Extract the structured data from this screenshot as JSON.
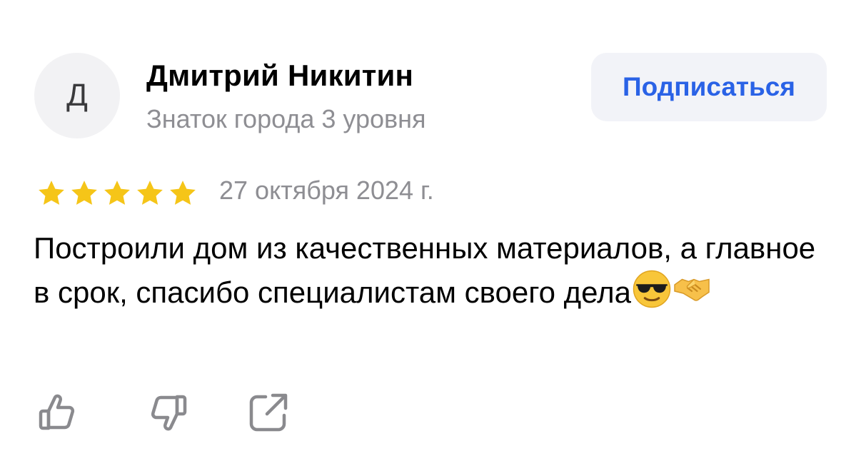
{
  "author": {
    "avatar_letter": "Д",
    "name": "Дмитрий Никитин",
    "level": "Знаток города 3 уровня"
  },
  "subscribe_label": "Подписаться",
  "review": {
    "rating": 5,
    "rating_max": 5,
    "date": "27 октября 2024 г.",
    "text": "Построили дом из качественных материалов, а главное в срок, спасибо специалистам своего дела",
    "emojis": [
      "smiling-face-with-sunglasses",
      "handshake"
    ]
  },
  "actions": {
    "like": "thumbs-up-icon",
    "dislike": "thumbs-down-icon",
    "share": "share-icon"
  },
  "colors": {
    "star": "#f5c518",
    "accent": "#2a62e6",
    "muted_text": "#8e8e93",
    "icon": "#8a8a8e"
  }
}
